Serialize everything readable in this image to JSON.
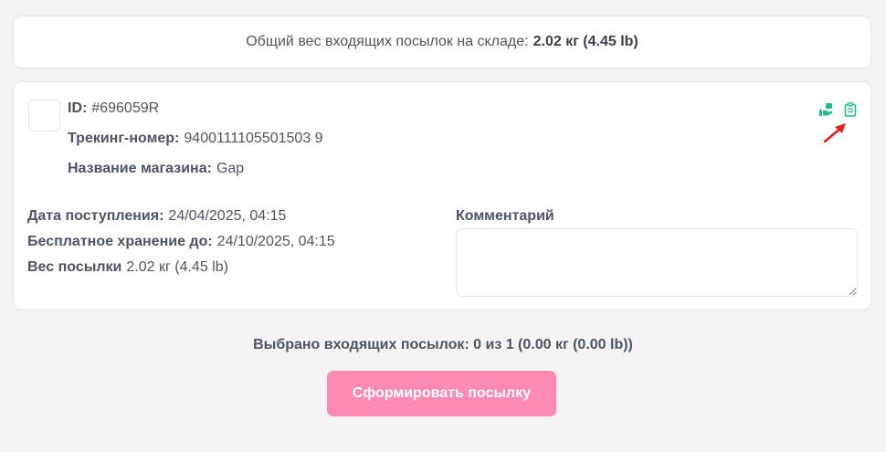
{
  "summary": {
    "label": "Общий вес входящих посылок на складе:",
    "value": "2.02 кг (4.45 lb)"
  },
  "parcel": {
    "id_label": "ID:",
    "id_value": "#696059R",
    "tracking_label": "Трекинг-номер:",
    "tracking_value": "9400111105501503 9",
    "shop_label": "Название магазина:",
    "shop_value": "Gap",
    "arrival_label": "Дата поступления:",
    "arrival_value": "24/04/2025, 04:15",
    "free_storage_label": "Бесплатное хранение до:",
    "free_storage_value": "24/10/2025, 04:15",
    "weight_label": "Вес посылки",
    "weight_value": "2.02 кг (4.45 lb)",
    "comment_label": "Комментарий",
    "comment_value": "",
    "icons": [
      "hand-package-icon",
      "clipboard-icon"
    ],
    "accent_color": "#1fbf8f"
  },
  "footer": {
    "selected_text": "Выбрано входящих посылок: 0 из 1 (0.00 кг (0.00 lb))",
    "button_label": "Сформировать посылку",
    "button_color": "#fc8ab5"
  }
}
